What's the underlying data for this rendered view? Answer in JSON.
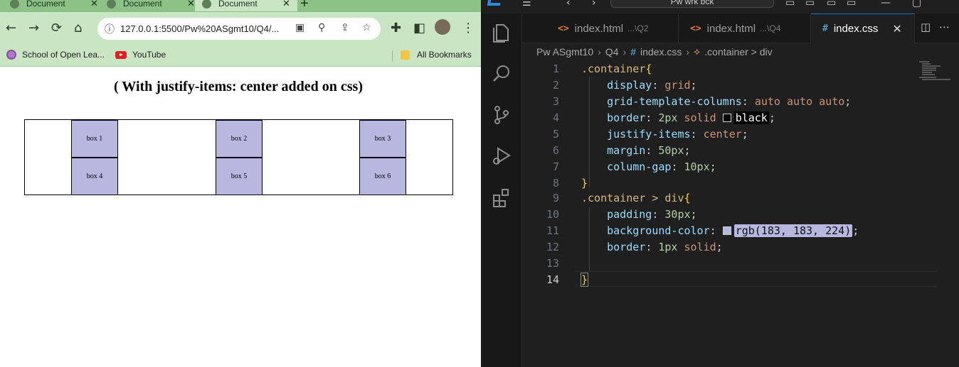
{
  "browser": {
    "tabs": [
      {
        "title": "Document",
        "close": "✕"
      },
      {
        "title": "Document",
        "close": "✕"
      },
      {
        "title": "Document",
        "close": "✕",
        "active": true
      }
    ],
    "new_tab": "+",
    "url": "127.0.0.1:5500/Pw%20ASgmt10/Q4/...",
    "bookmarks": [
      {
        "label": "School of Open Lea...",
        "icon": "school-icon"
      },
      {
        "label": "YouTube",
        "icon": "youtube-icon"
      }
    ],
    "all_bookmarks": "All Bookmarks",
    "page": {
      "heading": "( With justify-items: center added on css)",
      "boxes": [
        "box 1",
        "box 2",
        "box 3",
        "box 4",
        "box 5",
        "box 6"
      ]
    }
  },
  "vscode": {
    "command_center": "Pw wrk bck",
    "tabs": [
      {
        "icon": "<>",
        "name": "index.html",
        "hint": "...\\Q2"
      },
      {
        "icon": "<>",
        "name": "index.html",
        "hint": "...\\Q4"
      },
      {
        "icon": "#",
        "name": "index.css",
        "hint": "",
        "active": true,
        "close": "✕"
      }
    ],
    "breadcrumb": {
      "folder": "Pw ASgmt10",
      "subfolder": "Q4",
      "file": "index.css",
      "symbol": ".container > div"
    },
    "line_numbers": [
      "1",
      "2",
      "3",
      "4",
      "5",
      "6",
      "7",
      "8",
      "9",
      "10",
      "11",
      "12",
      "13",
      "14"
    ],
    "code": {
      "l1_sel": ".container",
      "l1_brace": "{",
      "l2_prop": "display",
      "l2_val": "grid",
      "l3_prop": "grid-template-columns",
      "l3_val": "auto auto auto",
      "l4_prop": "border",
      "l4_num": "2px",
      "l4_val": "solid",
      "l4_color": "black",
      "l5_prop": "justify-items",
      "l5_val": "center",
      "l6_prop": "margin",
      "l6_num": "50px",
      "l7_prop": "column-gap",
      "l7_num": "10px",
      "l8_brace": "}",
      "l9_sel": ".container > div",
      "l9_brace": "{",
      "l10_prop": "padding",
      "l10_num": "30px",
      "l11_prop": "background-color",
      "l11_color": "rgb(183, 183, 224)",
      "l12_prop": "border",
      "l12_num": "1px",
      "l12_val": "solid",
      "l14_brace": "}"
    },
    "colors": {
      "box_fill": "#b7b7e0",
      "accent": "#0078d4"
    }
  }
}
